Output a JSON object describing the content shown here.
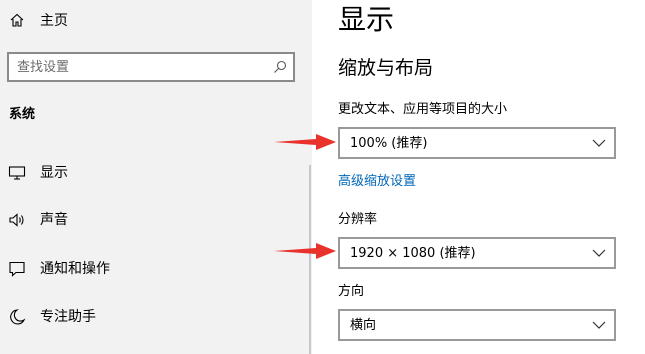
{
  "sidebar": {
    "home_label": "主页",
    "search_placeholder": "查找设置",
    "section_title": "系统",
    "items": [
      {
        "label": "显示",
        "icon": "monitor-icon"
      },
      {
        "label": "声音",
        "icon": "speaker-icon"
      },
      {
        "label": "通知和操作",
        "icon": "notification-icon"
      },
      {
        "label": "专注助手",
        "icon": "moon-icon"
      }
    ]
  },
  "main": {
    "title": "显示",
    "section": "缩放与布局",
    "scale": {
      "label": "更改文本、应用等项目的大小",
      "value": "100% (推荐)"
    },
    "advanced_link": "高级缩放设置",
    "resolution": {
      "label": "分辨率",
      "value": "1920 × 1080 (推荐)"
    },
    "orientation": {
      "label": "方向",
      "value": "横向"
    }
  },
  "colors": {
    "sidebar_bg": "#f2f2f2",
    "link": "#0067b8",
    "annotation_arrow": "#e8322b"
  }
}
